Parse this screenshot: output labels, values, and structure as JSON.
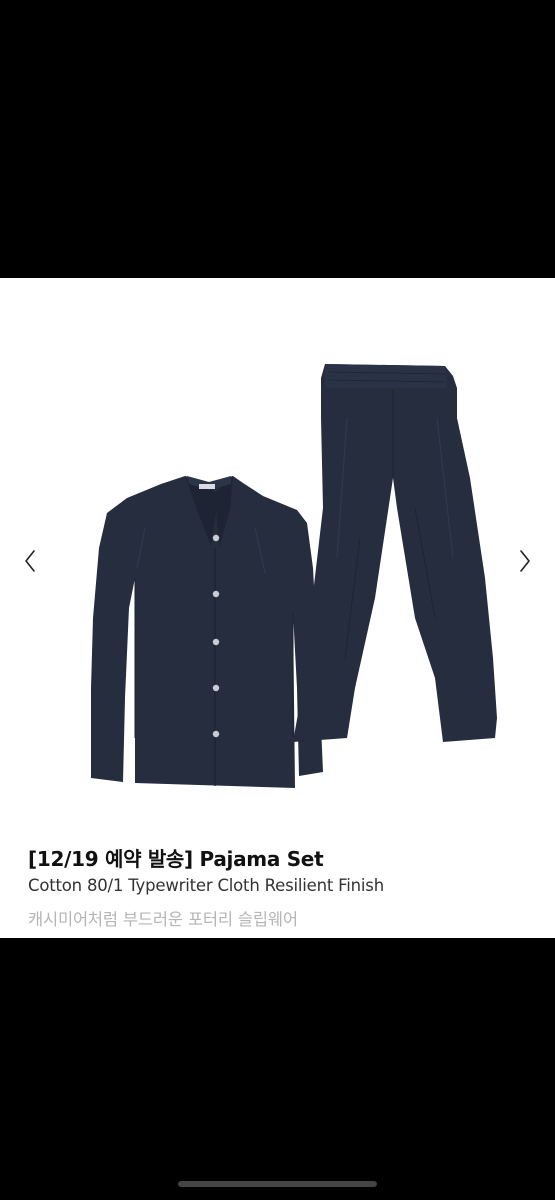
{
  "product": {
    "title": "[12/19 예약 발송] Pajama Set",
    "subtitle": "Cotton 80/1 Typewriter Cloth Resilient Finish",
    "description": "캐시미어처럼 부드러운 포터리 슬립웨어"
  },
  "carousel": {
    "prev_icon": "chevron-left-icon",
    "next_icon": "chevron-right-icon"
  },
  "colors": {
    "garment": "#262d3f",
    "background": "#ffffff",
    "letterbox": "#000000"
  }
}
